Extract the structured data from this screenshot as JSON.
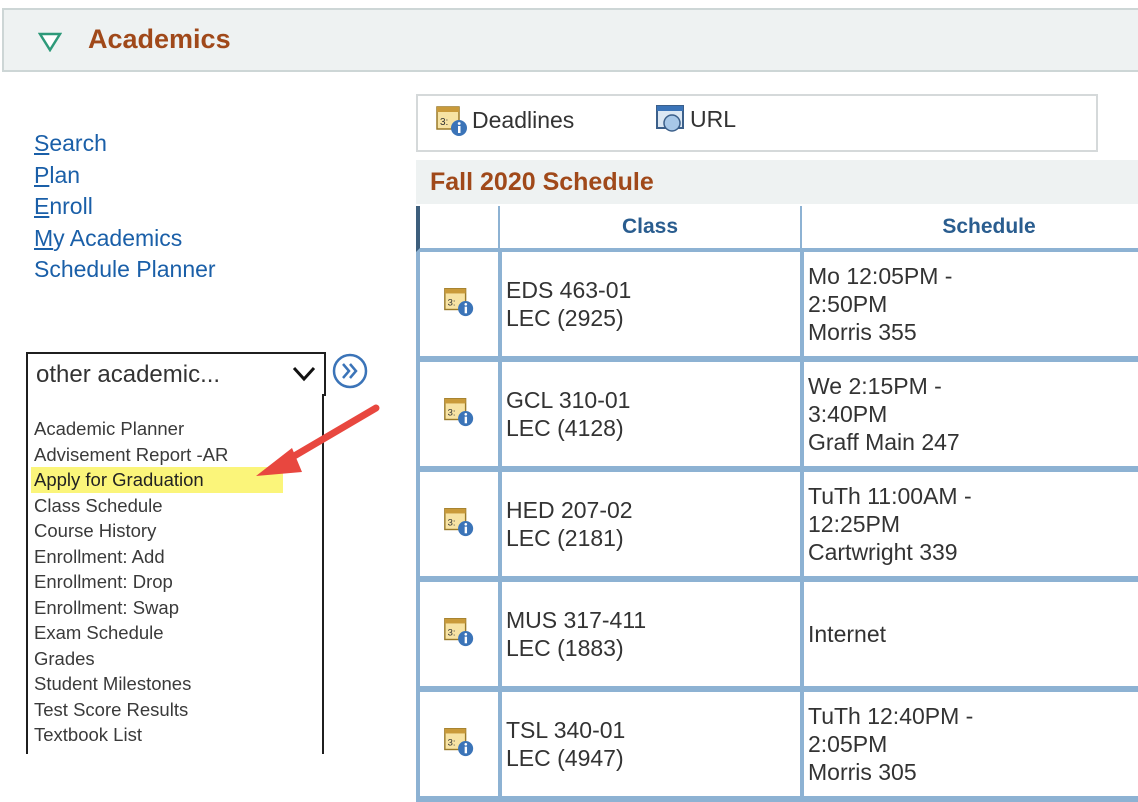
{
  "section": {
    "title": "Academics",
    "toggle_icon": "triangle-down-icon"
  },
  "nav": {
    "links": [
      {
        "access_key": "S",
        "rest": "earch"
      },
      {
        "access_key": "P",
        "rest": "lan"
      },
      {
        "access_key": "E",
        "rest": "nroll"
      },
      {
        "access_key": "M",
        "rest": "y Academics"
      },
      {
        "access_key": "",
        "rest": "Schedule Planner"
      }
    ]
  },
  "dropdown": {
    "selected": "other academic...",
    "options": [
      "Academic Planner",
      "Advisement Report -AR",
      "Apply for Graduation",
      "Class Schedule",
      "Course History",
      "Enrollment: Add",
      "Enrollment: Drop",
      "Enrollment: Swap",
      "Exam Schedule",
      "Grades",
      "Student Milestones",
      "Test Score Results",
      "Textbook List"
    ],
    "highlighted": "Apply for Graduation"
  },
  "links": {
    "deadlines": "Deadlines",
    "url": "URL"
  },
  "schedule": {
    "title": "Fall 2020 Schedule",
    "columns": [
      "",
      "Class",
      "Schedule"
    ],
    "rows": [
      {
        "course": "EDS 463-01",
        "section": "LEC (2925)",
        "time1": "Mo 12:05PM -",
        "time2": "2:50PM",
        "room": "Morris 355"
      },
      {
        "course": "GCL 310-01",
        "section": "LEC (4128)",
        "time1": "We 2:15PM -",
        "time2": "3:40PM",
        "room": "Graff Main 247"
      },
      {
        "course": "HED 207-02",
        "section": "LEC (2181)",
        "time1": "TuTh 11:00AM -",
        "time2": "12:25PM",
        "room": "Cartwright 339"
      },
      {
        "course": "MUS 317-411",
        "section": "LEC (1883)",
        "time1": "Internet",
        "time2": "",
        "room": ""
      },
      {
        "course": "TSL 340-01",
        "section": "LEC (4947)",
        "time1": "TuTh 12:40PM -",
        "time2": "2:05PM",
        "room": "Morris 305"
      }
    ]
  },
  "colors": {
    "accent_title": "#a0491a",
    "link": "#1a5fa8",
    "table_border": "#8db2d3",
    "highlight": "#fbf57a",
    "arrow": "#e8473f"
  }
}
